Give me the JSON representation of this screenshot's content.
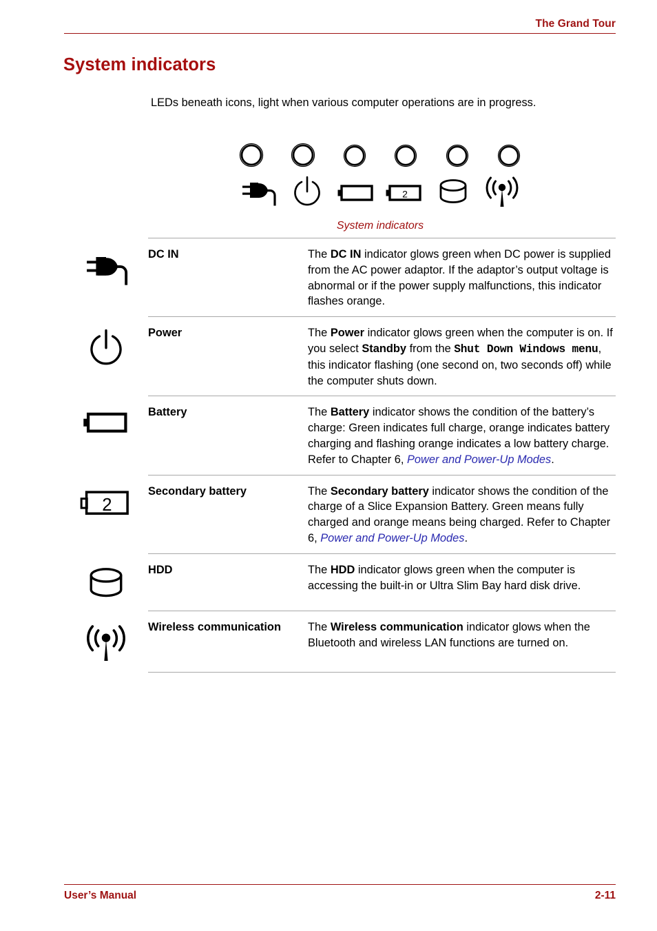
{
  "header": {
    "chapter_title": "The Grand Tour"
  },
  "section": {
    "title": "System indicators",
    "intro": "LEDs beneath icons, light when various computer operations are in progress."
  },
  "figure": {
    "caption": "System indicators",
    "led_count": 6,
    "icons": [
      "dc-in-plug-icon",
      "power-symbol-icon",
      "battery-icon",
      "secondary-battery-icon",
      "hdd-icon",
      "wireless-communication-icon"
    ],
    "secondary_battery_label": "2"
  },
  "indicators": [
    {
      "icon": "dc-in-plug-icon",
      "name": "DC IN",
      "desc_parts": [
        {
          "t": "The ",
          "style": "normal"
        },
        {
          "t": "DC IN",
          "style": "bold"
        },
        {
          "t": " indicator glows green when DC power is supplied from the AC power adaptor. If the adaptor’s output voltage is abnormal or if the power supply malfunctions, this indicator flashes orange.",
          "style": "normal"
        }
      ]
    },
    {
      "icon": "power-symbol-icon",
      "name": "Power",
      "desc_parts": [
        {
          "t": "The ",
          "style": "normal"
        },
        {
          "t": "Power",
          "style": "bold"
        },
        {
          "t": " indicator glows green when the computer is on. If you select ",
          "style": "normal"
        },
        {
          "t": "Standby",
          "style": "bold"
        },
        {
          "t": " from the ",
          "style": "normal"
        },
        {
          "t": "Shut Down Windows menu",
          "style": "mono"
        },
        {
          "t": ", this indicator flashing (one second on, two seconds off) while the computer shuts down.",
          "style": "normal"
        }
      ]
    },
    {
      "icon": "battery-icon",
      "name": "Battery",
      "desc_parts": [
        {
          "t": "The ",
          "style": "normal"
        },
        {
          "t": "Battery",
          "style": "bold"
        },
        {
          "t": " indicator shows the condition of the battery’s charge: Green indicates full charge, orange indicates battery charging and flashing orange indicates a low battery charge. Refer to Chapter 6, ",
          "style": "normal"
        },
        {
          "t": "Power and Power-Up Modes",
          "style": "xref"
        },
        {
          "t": ".",
          "style": "normal"
        }
      ]
    },
    {
      "icon": "secondary-battery-icon",
      "name": "Secondary battery",
      "desc_parts": [
        {
          "t": "The ",
          "style": "normal"
        },
        {
          "t": "Secondary battery",
          "style": "bold"
        },
        {
          "t": " indicator shows the condition of the charge of a Slice Expansion Battery. Green means fully charged and orange means being charged. Refer to Chapter 6, ",
          "style": "normal"
        },
        {
          "t": "Power and Power-Up Modes",
          "style": "xref"
        },
        {
          "t": ".",
          "style": "normal"
        }
      ]
    },
    {
      "icon": "hdd-icon",
      "name": "HDD",
      "desc_parts": [
        {
          "t": "The ",
          "style": "normal"
        },
        {
          "t": "HDD",
          "style": "bold"
        },
        {
          "t": " indicator glows green when the computer is accessing the built-in or Ultra Slim Bay hard disk drive.",
          "style": "normal"
        }
      ]
    },
    {
      "icon": "wireless-communication-icon",
      "name": "Wireless communication",
      "desc_parts": [
        {
          "t": "The ",
          "style": "normal"
        },
        {
          "t": "Wireless communication",
          "style": "bold"
        },
        {
          "t": " indicator glows when the Bluetooth and wireless LAN functions are turned on.",
          "style": "normal"
        }
      ]
    }
  ],
  "footer": {
    "left": "User’s Manual",
    "right": "2-11"
  },
  "colors": {
    "accent_red": "#9e1111",
    "heading_red": "#a60f0f",
    "caption_red": "#a01010",
    "xref_blue": "#2a2ab0",
    "rule_gray": "#a8a8a8"
  }
}
